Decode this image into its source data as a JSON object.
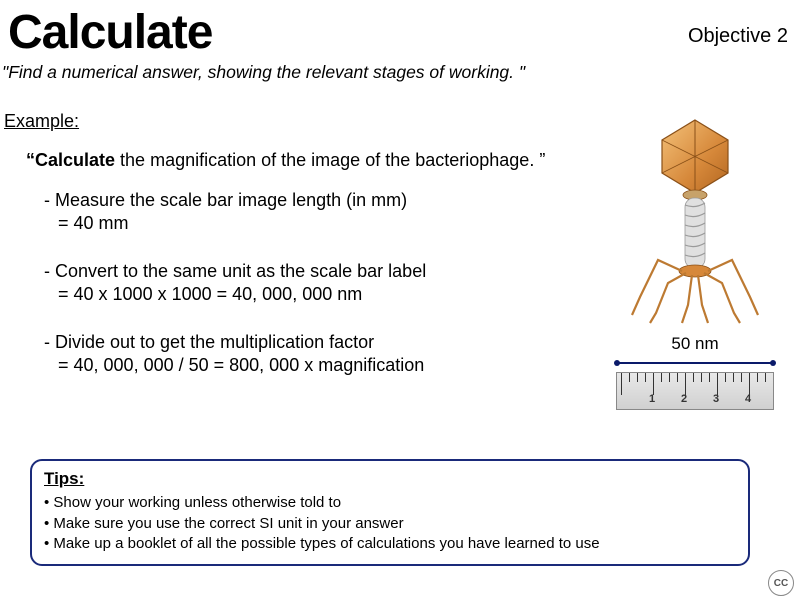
{
  "header": {
    "title": "Calculate",
    "objective": "Objective 2"
  },
  "definition": "\"Find a numerical answer, showing the relevant stages of working. \"",
  "example": {
    "label": "Example:",
    "prompt_bold": "“Calculate",
    "prompt_rest": " the magnification of the image of the bacteriophage. ”",
    "steps": [
      {
        "line1": "- Measure the scale bar image length (in mm)",
        "line2": "= 40 mm"
      },
      {
        "line1": "- Convert to the same unit as the scale bar label",
        "line2": "= 40 x 1000 x 1000    = 40, 000, 000 nm"
      },
      {
        "line1": "- Divide out to get the multiplication factor",
        "line2": "= 40, 000, 000 / 50       = 800, 000 x magnification"
      }
    ]
  },
  "scale": {
    "label": "50 nm",
    "ruler_numbers": [
      "1",
      "2",
      "3",
      "4"
    ]
  },
  "tips": {
    "title": "Tips:",
    "items": [
      "Show your working unless otherwise told to",
      "Make sure you use the correct SI unit in your answer",
      "Make up a booklet of all the possible types of calculations you have learned to use"
    ]
  },
  "badge": "CC"
}
